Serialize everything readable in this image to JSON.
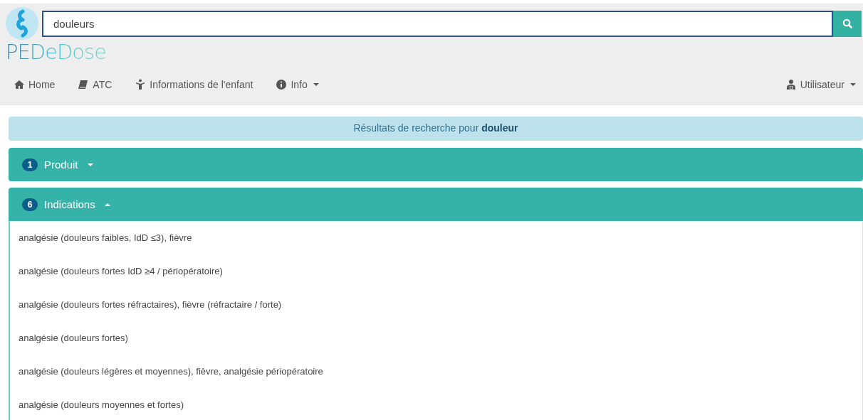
{
  "search": {
    "value": "douleurs"
  },
  "logo": {
    "text": "PEDeDose"
  },
  "nav": {
    "items": [
      {
        "label": "Home",
        "dropdown": false
      },
      {
        "label": "ATC",
        "dropdown": false
      },
      {
        "label": "Informations de l'enfant",
        "dropdown": false
      },
      {
        "label": "Info",
        "dropdown": true
      }
    ],
    "user": {
      "label": "Utilisateur",
      "dropdown": true
    }
  },
  "results_banner": {
    "text": "Résultats de recherche pour **douleur**"
  },
  "panels": [
    {
      "badge": "1",
      "title": "Produit",
      "expanded": false
    },
    {
      "badge": "6",
      "title": "Indications",
      "expanded": true,
      "items": [
        "analgésie (douleurs faibles, IdD ≤3), fièvre",
        "analgésie (douleurs fortes IdD ≥4 / périopératoire)",
        "analgésie (douleurs fortes réfractaires), fièvre (réfractaire / forte)",
        "analgésie (douleurs fortes)",
        "analgésie (douleurs légères et moyennes), fièvre, analgésie périopératoire",
        "analgésie (douleurs moyennes et fortes)"
      ]
    }
  ]
}
